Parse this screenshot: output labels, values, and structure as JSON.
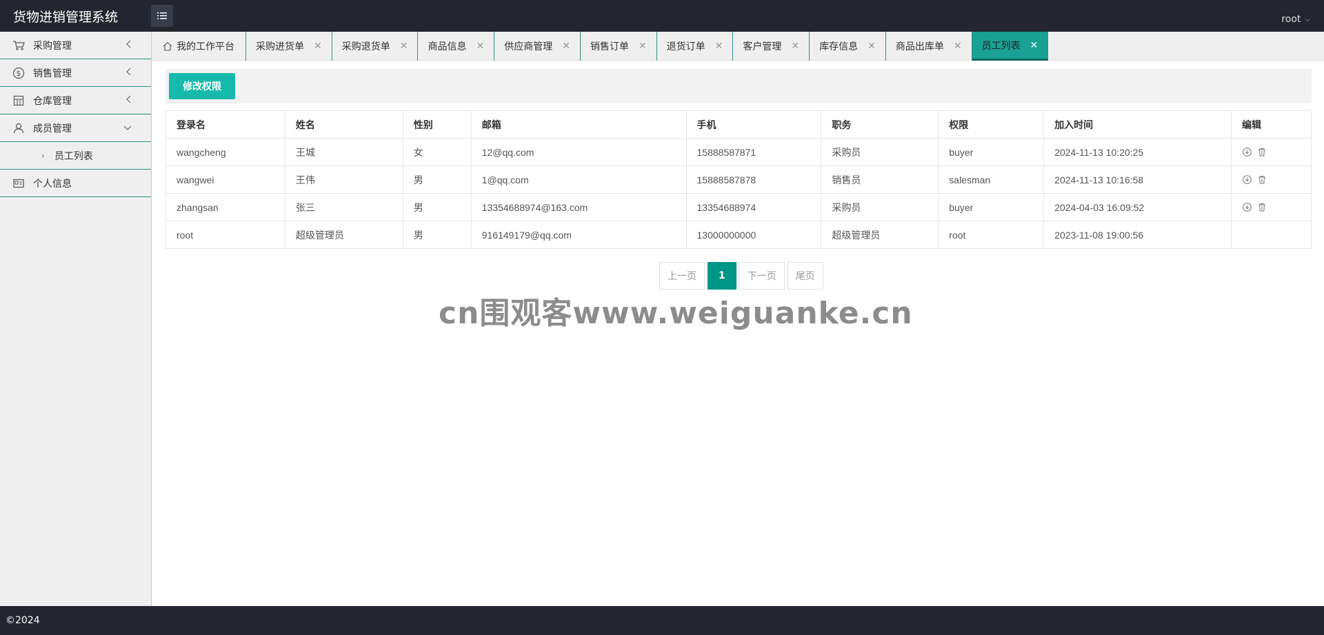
{
  "header": {
    "app_title": "货物进销管理系统",
    "user": "root"
  },
  "sidebar": {
    "items": [
      {
        "label": "采购管理",
        "icon": "cart-icon"
      },
      {
        "label": "销售管理",
        "icon": "dollar-icon"
      },
      {
        "label": "仓库管理",
        "icon": "warehouse-icon"
      },
      {
        "label": "成员管理",
        "icon": "user-icon"
      },
      {
        "label": "个人信息",
        "icon": "id-card-icon"
      }
    ],
    "sub_items": [
      {
        "label": "员工列表"
      }
    ]
  },
  "tabs": [
    {
      "label": "我的工作平台"
    },
    {
      "label": "采购进货单"
    },
    {
      "label": "采购退货单"
    },
    {
      "label": "商品信息"
    },
    {
      "label": "供应商管理"
    },
    {
      "label": "销售订单"
    },
    {
      "label": "退货订单"
    },
    {
      "label": "客户管理"
    },
    {
      "label": "库存信息"
    },
    {
      "label": "商品出库单"
    },
    {
      "label": "员工列表"
    }
  ],
  "toolbar": {
    "edit_permission_label": "修改权限"
  },
  "table": {
    "headers": [
      "登录名",
      "姓名",
      "性别",
      "邮箱",
      "手机",
      "职务",
      "权限",
      "加入时间",
      "编辑"
    ],
    "rows": [
      [
        "wangcheng",
        "王城",
        "女",
        "12@qq.com",
        "15888587871",
        "采购员",
        "buyer",
        "2024-11-13 10:20:25"
      ],
      [
        "wangwei",
        "王伟",
        "男",
        "1@qq.com",
        "15888587878",
        "销售员",
        "salesman",
        "2024-11-13 10:16:58"
      ],
      [
        "zhangsan",
        "张三",
        "男",
        "13354688974@163.com",
        "13354688974",
        "采购员",
        "buyer",
        "2024-04-03 16:09:52"
      ],
      [
        "root",
        "超级管理员",
        "男",
        "916149179@qq.com",
        "13000000000",
        "超级管理员",
        "root",
        "2023-11-08 19:00:56"
      ]
    ]
  },
  "pagination": {
    "prev": "上一页",
    "current": "1",
    "next": "下一页",
    "last": "尾页"
  },
  "watermark": "cn围观客www.weiguanke.cn",
  "footer": {
    "copyright": "©2024"
  },
  "colors": {
    "accent": "#16baaa",
    "active_tab": "#1aa094",
    "topbar": "#23262e"
  }
}
